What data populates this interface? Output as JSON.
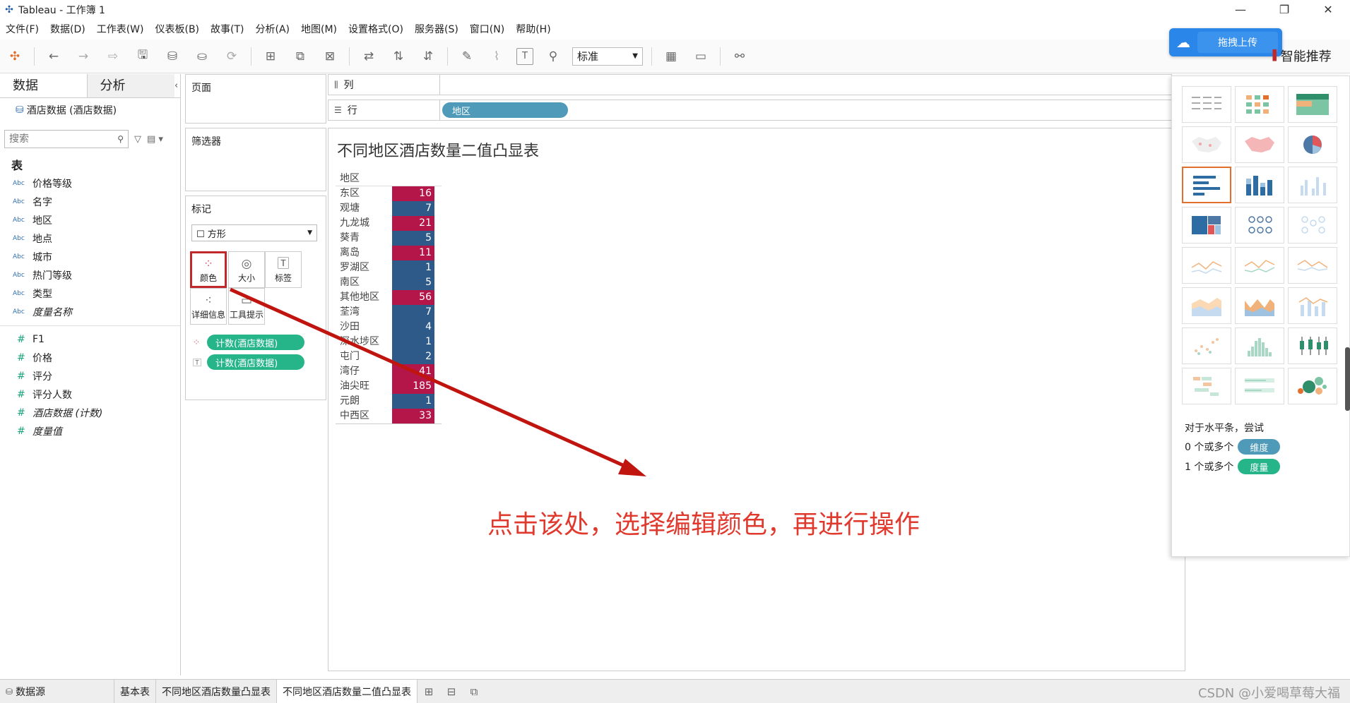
{
  "window": {
    "title": "Tableau - 工作簿 1",
    "minimize": "—",
    "maximize": "❐",
    "close": "✕"
  },
  "menu": [
    "文件(F)",
    "数据(D)",
    "工作表(W)",
    "仪表板(B)",
    "故事(T)",
    "分析(A)",
    "地图(M)",
    "设置格式(O)",
    "服务器(S)",
    "窗口(N)",
    "帮助(H)"
  ],
  "toolbar": {
    "fit_select": "标准"
  },
  "upload": {
    "label": "拖拽上传"
  },
  "datapane": {
    "tab_data": "数据",
    "tab_analysis": "分析",
    "datasource": "酒店数据 (酒店数据)",
    "search_placeholder": "搜索",
    "section_table": "表",
    "dimensions": [
      {
        "type": "Abc",
        "name": "价格等级",
        "italic": false
      },
      {
        "type": "Abc",
        "name": "名字",
        "italic": false
      },
      {
        "type": "Abc",
        "name": "地区",
        "italic": false
      },
      {
        "type": "Abc",
        "name": "地点",
        "italic": false
      },
      {
        "type": "Abc",
        "name": "城市",
        "italic": false
      },
      {
        "type": "Abc",
        "name": "热门等级",
        "italic": false
      },
      {
        "type": "Abc",
        "name": "类型",
        "italic": false
      },
      {
        "type": "Abc",
        "name": "度量名称",
        "italic": true
      }
    ],
    "measures": [
      {
        "type": "#",
        "name": "F1",
        "italic": false
      },
      {
        "type": "#",
        "name": "价格",
        "italic": false
      },
      {
        "type": "#",
        "name": "评分",
        "italic": false
      },
      {
        "type": "#",
        "name": "评分人数",
        "italic": false
      },
      {
        "type": "#",
        "name": "酒店数据 (计数)",
        "italic": true
      },
      {
        "type": "#",
        "name": "度量值",
        "italic": true
      }
    ]
  },
  "cards": {
    "pages": "页面",
    "filters": "筛选器",
    "marks": "标记",
    "mark_type": "方形",
    "buttons": {
      "color": "颜色",
      "size": "大小",
      "label": "标签",
      "detail": "详细信息",
      "tooltip": "工具提示"
    },
    "pills": [
      "计数(酒店数据)",
      "计数(酒店数据)"
    ]
  },
  "shelves": {
    "columns": "列",
    "rows": "行",
    "row_pill": "地区"
  },
  "viz": {
    "title": "不同地区酒店数量二值凸显表",
    "header": "地区",
    "colors": {
      "high": "#b5164a",
      "low": "#2e5a8a"
    },
    "rows": [
      {
        "label": "东区",
        "value": "16",
        "high": true
      },
      {
        "label": "观塘",
        "value": "7",
        "high": false
      },
      {
        "label": "九龙城",
        "value": "21",
        "high": true
      },
      {
        "label": "葵青",
        "value": "5",
        "high": false
      },
      {
        "label": "离岛",
        "value": "11",
        "high": true
      },
      {
        "label": "罗湖区",
        "value": "1",
        "high": false
      },
      {
        "label": "南区",
        "value": "5",
        "high": false
      },
      {
        "label": "其他地区",
        "value": "56",
        "high": true
      },
      {
        "label": "荃湾",
        "value": "7",
        "high": false
      },
      {
        "label": "沙田",
        "value": "4",
        "high": false
      },
      {
        "label": "深水埗区",
        "value": "1",
        "high": false
      },
      {
        "label": "屯门",
        "value": "2",
        "high": false
      },
      {
        "label": "湾仔",
        "value": "41",
        "high": true
      },
      {
        "label": "油尖旺",
        "value": "185",
        "high": true
      },
      {
        "label": "元朗",
        "value": "1",
        "high": false
      },
      {
        "label": "中西区",
        "value": "33",
        "high": true
      }
    ]
  },
  "annotation": {
    "text": "点击该处，选择编辑颜色，再进行操作",
    "color": "#e03a2f"
  },
  "showme": {
    "title": "智能推荐",
    "hint": "对于水平条，尝试",
    "req1_text": "0 个或多个",
    "req1_pill": "维度",
    "req2_text": "1 个或多个",
    "req2_pill": "度量",
    "dim_color": "#4e9ab8",
    "meas_color": "#26b589"
  },
  "bottom": {
    "datasource": "数据源",
    "sheets": [
      "基本表",
      "不同地区酒店数量凸显表",
      "不同地区酒店数量二值凸显表"
    ]
  },
  "watermark": "CSDN @小爱喝草莓大福"
}
